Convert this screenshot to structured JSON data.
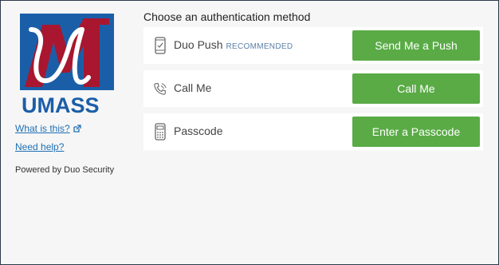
{
  "sidebar": {
    "logo_text": "UMASS",
    "links": {
      "what_is_this": "What is this?",
      "need_help": "Need help?"
    },
    "powered_by": "Powered by Duo Security"
  },
  "main": {
    "heading": "Choose an authentication method",
    "methods": [
      {
        "label": "Duo Push",
        "tag": "RECOMMENDED",
        "icon": "phone-icon",
        "button": "Send Me a Push"
      },
      {
        "label": "Call Me",
        "tag": "",
        "icon": "phone-call-icon",
        "button": "Call Me"
      },
      {
        "label": "Passcode",
        "tag": "",
        "icon": "passcode-device-icon",
        "button": "Enter a Passcode"
      }
    ]
  },
  "colors": {
    "button_green": "#5aab46",
    "logo_blue": "#1b5ea8",
    "logo_red": "#a8172f",
    "link_blue": "#1f6fb5",
    "background": "#f6f6f6"
  }
}
